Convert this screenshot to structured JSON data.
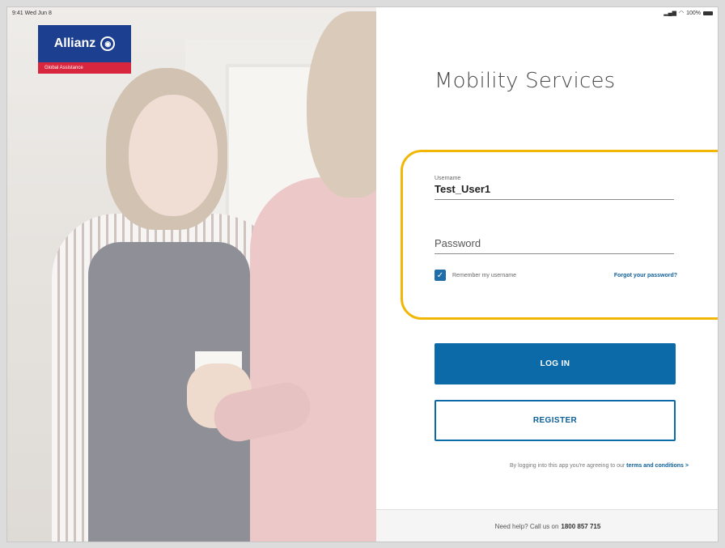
{
  "status_bar": {
    "time_date": "9:41 Wed Jun 8",
    "right_info": "100%",
    "icons": [
      "signal-icon",
      "wifi-icon",
      "battery-icon"
    ]
  },
  "brand": {
    "name": "Allianz",
    "sub": "Global Assistance",
    "colors": {
      "primary": "#1d3f8f",
      "accent": "#d7263d"
    }
  },
  "app_title": "Mobility Services",
  "username": {
    "label": "Username",
    "value": "Test_User1"
  },
  "password": {
    "placeholder": "Password"
  },
  "remember": {
    "label": "Remember my username",
    "checked": true
  },
  "forgot_link": "Forgot your password?",
  "login_button": "LOG IN",
  "register_button": "REGISTER",
  "terms": {
    "prefix": "By logging into this app you're agreeing to our",
    "link": "terms and conditions",
    "suffix": ">"
  },
  "help": {
    "prefix": "Need help? Call us on",
    "phone": "1800 857 715"
  },
  "ui_colors": {
    "button_primary": "#0d6aa8",
    "highlight": "#f2b705"
  }
}
